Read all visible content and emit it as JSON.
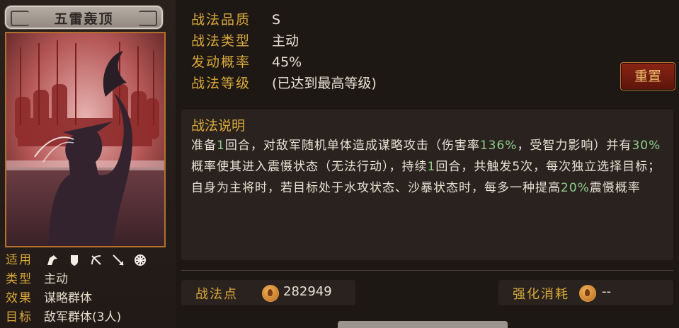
{
  "skill": {
    "name": "五雷轰顶"
  },
  "attributes": {
    "applicable_label": "适用",
    "type_label": "类型",
    "type_value": "主动",
    "effect_label": "效果",
    "effect_value": "谋略群体",
    "target_label": "目标",
    "target_value": "敌军群体(3人)",
    "troop_icons": [
      "cavalry-icon",
      "shield-icon",
      "bow-icon",
      "spear-icon",
      "siege-icon"
    ]
  },
  "info": {
    "quality_label": "战法品质",
    "quality_value": "S",
    "kind_label": "战法类型",
    "kind_value": "主动",
    "rate_label": "发动概率",
    "rate_value": "45%",
    "level_label": "战法等级",
    "level_value": "(已达到最高等级)"
  },
  "actions": {
    "reset_label": "重置"
  },
  "description": {
    "title": "战法说明",
    "seg1": "准备",
    "hl1": "1",
    "seg2": "回合，对敌军随机单体造成谋略攻击（伤害率",
    "hl2": "136%",
    "seg3": "，受智力影响）并有",
    "hl3": "30%",
    "seg4": "概率使其进入震慑状态（无法行动），持续",
    "hl4": "1",
    "seg5": "回合，共触发5次，每次独立选择目标；自身为主将时，若目标处于水攻状态、沙暴状态时，每多一种提高",
    "hl5": "20%",
    "seg6": "震慑概率"
  },
  "footer": {
    "points_label": "战法点",
    "points_value": "282949",
    "cost_label": "强化消耗",
    "cost_value": "--"
  },
  "colors": {
    "accent_gold": "#d9a93a",
    "highlight_green": "#8fd08a",
    "button_red": "#8a2414"
  }
}
